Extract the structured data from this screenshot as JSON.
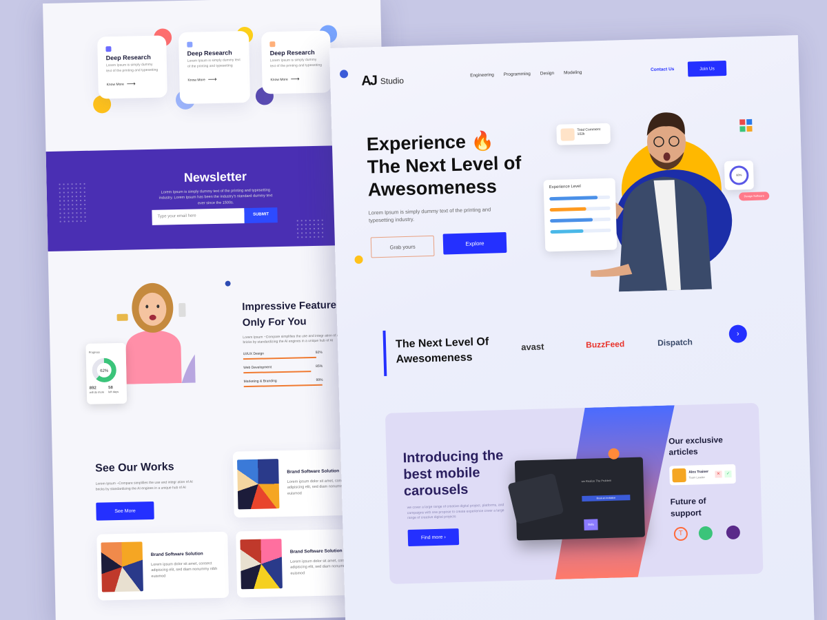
{
  "left_page": {
    "feature_cards": [
      {
        "title": "Deep Research",
        "desc": "Lorem Ipsum is simply dummy text of the printing and typesetting",
        "link": "Know More"
      },
      {
        "title": "Deep Research",
        "desc": "Lorem Ipsum is simply dummy text of the printing and typesetting",
        "link": "Know More"
      },
      {
        "title": "Deep Research",
        "desc": "Lorem Ipsum is simply dummy text of the printing and typesetting",
        "link": "Know More"
      }
    ],
    "newsletter": {
      "title": "Newsletter",
      "text": "Lorem Ipsum is simply dummy text of the printing and typesetting industry. Lorem Ipsum has been the industry's standard dummy text ever since the 1500s.",
      "placeholder": "Type your email here",
      "submit": "SUBMIT"
    },
    "stat_card": {
      "value_pct": "62%",
      "label": "Progress",
      "stats": [
        {
          "num": "892",
          "lbl": "will do more"
        },
        {
          "num": "58",
          "lbl": "left days"
        }
      ]
    },
    "features": {
      "title_line1": "Impressive Feature",
      "title_line2": "Only For You",
      "text": "Lorem Ipsum ~Compare simplifies the use and integr ation of AI bricks by standardizing the AI engines in a unique hub of AI",
      "bars": [
        {
          "label": "UI/UX Design",
          "value": "92%",
          "pct": 0.92
        },
        {
          "label": "Web Development",
          "value": "85%",
          "pct": 0.85
        },
        {
          "label": "Marketing & Branding",
          "value": "99%",
          "pct": 0.99
        }
      ]
    },
    "works": {
      "title": "See Our Works",
      "text": "Lorem Ipsum ~Compare simplifies the use and integr ation of AI bricks by standardizing the AI engines in a unique hub of AI",
      "button": "See More",
      "cards": [
        {
          "title": "Brand Software Solution",
          "text": "Lorem ipsum dolor sit amet, consect adipiscing elit, sed diam nonummy nibh euismod"
        },
        {
          "title": "Brand Software Solution",
          "text": "Lorem ipsum dolor sit amet, consect adipiscing elit, sed diam nonummy nibh euismod"
        },
        {
          "title": "Brand Software Solution",
          "text": "Lorem ipsum dolor sit amet, consect adipiscing elit, sed diam nonummy nibh euismod"
        }
      ]
    }
  },
  "right_page": {
    "logo_mark": "AJ",
    "logo_name": "Studio",
    "nav": [
      "Engineering",
      "Programming",
      "Design",
      "Modeling"
    ],
    "contact": "Contact Us",
    "join": "Join Us",
    "hero": {
      "line1": "Experience 🔥",
      "line2": "The Next Level of",
      "line3": "Awesomeness",
      "sub": "Lorem Ipsum is simply dummy text of the printing and typesetting industry.",
      "btn_outline": "Grab yours",
      "btn_primary": "Explore"
    },
    "total_comment": {
      "label": "Total Comment",
      "value": "102k"
    },
    "experience": {
      "title": "Experience Level",
      "rows": [
        {
          "label": "Label 1",
          "pct": 0.8,
          "color": "#4a90e8"
        },
        {
          "label": "Label 2",
          "pct": 0.6,
          "color": "#ff9a1f"
        },
        {
          "label": "Label 3",
          "pct": 0.7,
          "color": "#4a90e8"
        },
        {
          "label": "Label 4",
          "pct": 0.55,
          "color": "#4ab8e8"
        }
      ]
    },
    "progress_card": {
      "value": "60%"
    },
    "pill_text": "Design Software",
    "brands_title": {
      "line1": "The Next Level Of",
      "line2": "Awesomeness"
    },
    "brands": [
      "avast",
      "BuzzFeed",
      "Dispatch"
    ],
    "promo": {
      "line1": "Introducing the",
      "line2": "best mobile",
      "line3": "carousels",
      "text": "we cover a large range of creative digital project, platforms, and campaigns with one propose to create experience cover a large range of creative digital projects",
      "button": "Find more",
      "device_text": "we Realize The Problem",
      "device_button": "Book an invitation",
      "device_tag": "Skills"
    },
    "side": {
      "articles_title_1": "Our  exclusive",
      "articles_title_2": "articles",
      "person_name": "Alex Trainer",
      "person_role": "Team Leader",
      "support_1": "Future of",
      "support_2": "support"
    }
  },
  "colors": {
    "primary": "#2430ff",
    "newsletter": "#4a2fb3",
    "orange": "#f07a30",
    "yellow": "#ffb800"
  }
}
